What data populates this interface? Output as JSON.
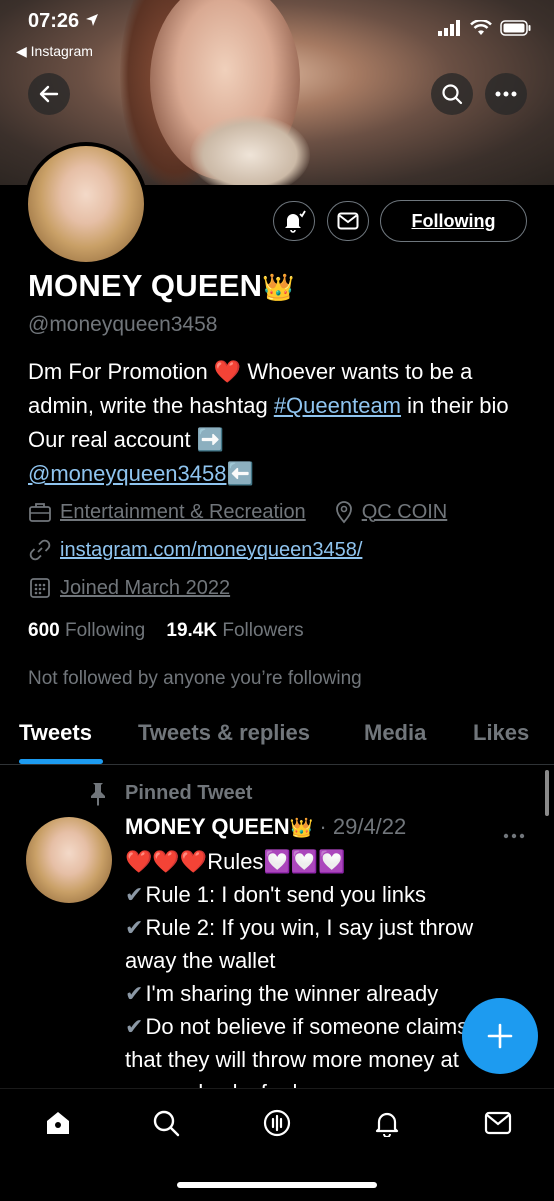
{
  "status_bar": {
    "time": "07:26",
    "back_app": "Instagram"
  },
  "profile": {
    "name": "MONEY QUEEN",
    "name_emoji": "👑",
    "handle": "@moneyqueen3458",
    "follow_button": "Following",
    "bio": {
      "part1": "Dm For Promotion ",
      "heart": "❤️",
      "part2": " Whoever wants to be a admin, write the hashtag ",
      "hashtag": "#Queenteam",
      "part3": " in their bio Our real account ",
      "arrow_right": "➡️",
      "mention": "@moneyqueen3458",
      "arrow_left": "⬅️"
    },
    "category": "Entertainment & Recreation",
    "location": "QC COIN",
    "website": "instagram.com/moneyqueen3458/",
    "joined": "Joined March 2022",
    "following_count": "600",
    "following_label": "Following",
    "followers_count": "19.4K",
    "followers_label": "Followers",
    "not_followed": "Not followed by anyone you’re following"
  },
  "tabs": [
    {
      "label": "Tweets",
      "active": true
    },
    {
      "label": "Tweets & replies",
      "active": false
    },
    {
      "label": "Media",
      "active": false
    },
    {
      "label": "Likes",
      "active": false
    }
  ],
  "pinned_tweet": {
    "pinned_label": "Pinned Tweet",
    "author": "MONEY QUEEN",
    "author_emoji": "👑",
    "date": "· 29/4/22",
    "hearts": "❤️❤️❤️",
    "rules_label": "Rules",
    "purple_hearts": "💟💟💟",
    "lines": [
      "Rule 1: I don't send you links",
      "Rule 2: If you win, I say just throw away the wallet",
      "I'm sharing the winner already",
      "Do not believe if someone claims that they will throw more money at you and asks for less"
    ]
  },
  "colors": {
    "accent": "#1d9bf0",
    "link": "#8fc4ef",
    "muted": "#71767b",
    "background": "#000000"
  }
}
